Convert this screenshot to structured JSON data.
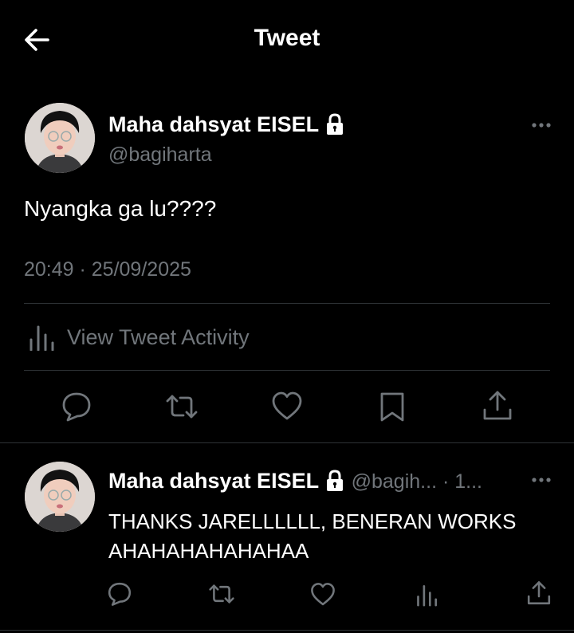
{
  "header": {
    "title": "Tweet"
  },
  "tweet": {
    "author_name": "Maha dahsyat EISEL",
    "author_handle": "@bagiharta",
    "text": "Nyangka ga lu????",
    "timestamp": "20:49 · 25/09/2025",
    "activity_label": "View Tweet Activity"
  },
  "reply": {
    "author_name": "Maha dahsyat EISEL",
    "handle_time": "@bagih... · 1...",
    "text": "THANKS JARELLLLLL, BENERAN WORKS AHAHAHAHAHAHAA"
  },
  "colors": {
    "background": "#000000",
    "text": "#e7e9ea",
    "muted": "#71767b",
    "divider": "#2f3336"
  }
}
